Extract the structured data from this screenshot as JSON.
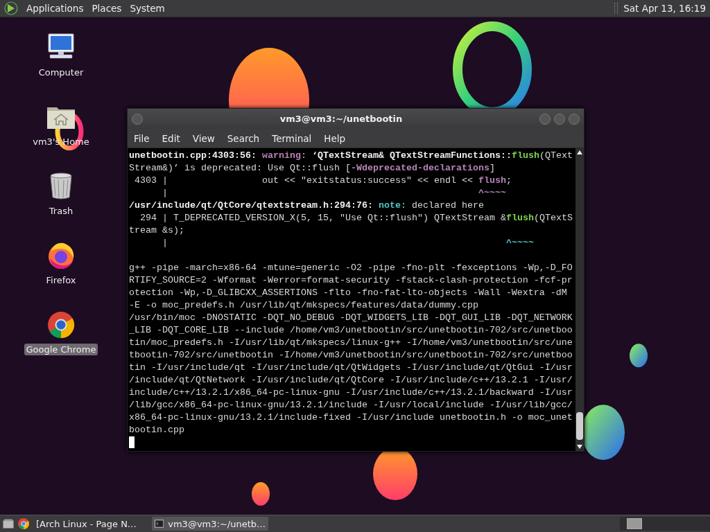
{
  "top_panel": {
    "menus": [
      "Applications",
      "Places",
      "System"
    ],
    "clock": "Sat Apr 13, 16:19"
  },
  "desktop_icons": [
    {
      "kind": "computer",
      "label": "Computer",
      "selected": false
    },
    {
      "kind": "home",
      "label": "vm3's Home",
      "selected": false
    },
    {
      "kind": "trash",
      "label": "Trash",
      "selected": false
    },
    {
      "kind": "firefox",
      "label": "Firefox",
      "selected": false
    },
    {
      "kind": "chrome",
      "label": "Google Chrome",
      "selected": true
    }
  ],
  "terminal": {
    "title": "vm3@vm3:~/unetbootin",
    "menu": [
      "File",
      "Edit",
      "View",
      "Search",
      "Terminal",
      "Help"
    ],
    "lines": [
      {
        "segments": [
          {
            "text": "unetbootin.cpp:4303:56: ",
            "kind": "location"
          },
          {
            "text": "warning: ",
            "kind": "warning"
          },
          {
            "text": "‘QTextStream& QTextStreamFunctions::",
            "kind": "location"
          },
          {
            "text": "flush",
            "kind": "highlight"
          },
          {
            "text": "(QText",
            "kind": "text"
          }
        ]
      },
      {
        "segments": [
          {
            "text": "Stream&)’ is deprecated: Use Qt::flush [",
            "kind": "text"
          },
          {
            "text": "-Wdeprecated-declarations",
            "kind": "warning"
          },
          {
            "text": "]",
            "kind": "text"
          }
        ]
      },
      {
        "segments": [
          {
            "text": " 4303 |                 out << \"exitstatus:success\" << endl << ",
            "kind": "text"
          },
          {
            "text": "flush",
            "kind": "warning"
          },
          {
            "text": ";",
            "kind": "text"
          }
        ]
      },
      {
        "segments": [
          {
            "text": "      |                                                        ",
            "kind": "text"
          },
          {
            "text": "^~~~~",
            "kind": "warning"
          }
        ]
      },
      {
        "segments": [
          {
            "text": "/usr/include/qt/QtCore/qtextstream.h:294:76: ",
            "kind": "location"
          },
          {
            "text": "note: ",
            "kind": "note"
          },
          {
            "text": "declared here",
            "kind": "text"
          }
        ]
      },
      {
        "segments": [
          {
            "text": "  294 | T_DEPRECATED_VERSION_X(5, 15, \"Use Qt::flush\") QTextStream &",
            "kind": "text"
          },
          {
            "text": "flush",
            "kind": "highlight"
          },
          {
            "text": "(QTextS",
            "kind": "text"
          }
        ]
      },
      {
        "segments": [
          {
            "text": "tream &s);",
            "kind": "text"
          }
        ]
      },
      {
        "segments": [
          {
            "text": "      |                                                             ",
            "kind": "text"
          },
          {
            "text": "^~~~~",
            "kind": "note"
          }
        ]
      },
      {
        "blank_before": true,
        "segments": [
          {
            "text": "g++ -pipe -march=x86-64 -mtune=generic -O2 -pipe -fno-plt -fexceptions -Wp,-D_FO",
            "kind": "text"
          }
        ]
      },
      {
        "segments": [
          {
            "text": "RTIFY_SOURCE=2 -Wformat -Werror=format-security -fstack-clash-protection -fcf-pr",
            "kind": "text"
          }
        ]
      },
      {
        "segments": [
          {
            "text": "otection -Wp,-D_GLIBCXX_ASSERTIONS -flto -fno-fat-lto-objects -Wall -Wextra -dM",
            "kind": "text"
          }
        ]
      },
      {
        "segments": [
          {
            "text": "-E -o moc_predefs.h /usr/lib/qt/mkspecs/features/data/dummy.cpp",
            "kind": "text"
          }
        ]
      },
      {
        "segments": [
          {
            "text": "/usr/bin/moc -DNOSTATIC -DQT_NO_DEBUG -DQT_WIDGETS_LIB -DQT_GUI_LIB -DQT_NETWORK",
            "kind": "text"
          }
        ]
      },
      {
        "segments": [
          {
            "text": "_LIB -DQT_CORE_LIB --include /home/vm3/unetbootin/src/unetbootin-702/src/unetboo",
            "kind": "text"
          }
        ]
      },
      {
        "segments": [
          {
            "text": "tin/moc_predefs.h -I/usr/lib/qt/mkspecs/linux-g++ -I/home/vm3/unetbootin/src/une",
            "kind": "text"
          }
        ]
      },
      {
        "segments": [
          {
            "text": "tbootin-702/src/unetbootin -I/home/vm3/unetbootin/src/unetbootin-702/src/unetboo",
            "kind": "text"
          }
        ]
      },
      {
        "segments": [
          {
            "text": "tin -I/usr/include/qt -I/usr/include/qt/QtWidgets -I/usr/include/qt/QtGui -I/usr",
            "kind": "text"
          }
        ]
      },
      {
        "segments": [
          {
            "text": "/include/qt/QtNetwork -I/usr/include/qt/QtCore -I/usr/include/c++/13.2.1 -I/usr/",
            "kind": "text"
          }
        ]
      },
      {
        "segments": [
          {
            "text": "include/c++/13.2.1/x86_64-pc-linux-gnu -I/usr/include/c++/13.2.1/backward -I/usr",
            "kind": "text"
          }
        ]
      },
      {
        "segments": [
          {
            "text": "/lib/gcc/x86_64-pc-linux-gnu/13.2.1/include -I/usr/local/include -I/usr/lib/gcc/",
            "kind": "text"
          }
        ]
      },
      {
        "segments": [
          {
            "text": "x86_64-pc-linux-gnu/13.2.1/include-fixed -I/usr/include unetbootin.h -o moc_unet",
            "kind": "text"
          }
        ]
      },
      {
        "segments": [
          {
            "text": "bootin.cpp",
            "kind": "text"
          }
        ]
      }
    ]
  },
  "taskbar": {
    "tasks": [
      {
        "kind": "browser",
        "label": "[Arch Linux - Page N…",
        "selected": false
      },
      {
        "kind": "terminal",
        "label": "vm3@vm3:~/unetb…",
        "selected": true
      }
    ]
  }
}
